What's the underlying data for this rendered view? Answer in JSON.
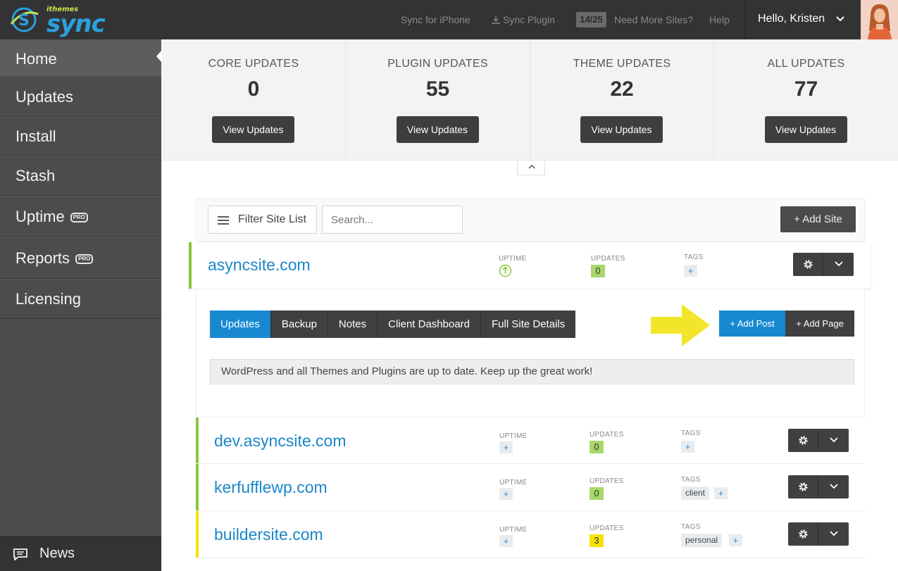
{
  "header": {
    "logo_top": "ithemes",
    "logo_main": "sync",
    "sync_iphone": "Sync for iPhone",
    "sync_plugin": "Sync Plugin",
    "quota": "14/25",
    "need_more": "Need More Sites?",
    "help": "Help",
    "greeting": "Hello, Kristen"
  },
  "sidebar": {
    "items": [
      {
        "label": "Home",
        "pro": ""
      },
      {
        "label": "Updates",
        "pro": ""
      },
      {
        "label": "Install",
        "pro": ""
      },
      {
        "label": "Stash",
        "pro": ""
      },
      {
        "label": "Uptime",
        "pro": "PRO"
      },
      {
        "label": "Reports",
        "pro": "PRO"
      },
      {
        "label": "Licensing",
        "pro": ""
      }
    ],
    "news": "News"
  },
  "stats": [
    {
      "label": "CORE UPDATES",
      "value": "0",
      "button": "View Updates"
    },
    {
      "label": "PLUGIN UPDATES",
      "value": "55",
      "button": "View Updates"
    },
    {
      "label": "THEME UPDATES",
      "value": "22",
      "button": "View Updates"
    },
    {
      "label": "ALL UPDATES",
      "value": "77",
      "button": "View Updates"
    }
  ],
  "toolbar": {
    "filter": "Filter Site List",
    "search_placeholder": "Search...",
    "add_site": "+  Add Site"
  },
  "columns": {
    "uptime": "UPTIME",
    "updates": "UPDATES",
    "tags": "TAGS"
  },
  "sites": [
    {
      "name": "asyncsite.com",
      "updates": "0",
      "tags": [],
      "bar_color": "#8cc63f"
    },
    {
      "name": "dev.asyncsite.com",
      "updates": "0",
      "tags": [],
      "bar_color": "#8cc63f"
    },
    {
      "name": "kerfufflewp.com",
      "updates": "0",
      "tags": [
        "client"
      ],
      "bar_color": "#8cc63f"
    },
    {
      "name": "buildersite.com",
      "updates": "3",
      "tags": [
        "personal"
      ],
      "bar_color": "#f5e400"
    }
  ],
  "plus": "+",
  "detail": {
    "tabs": [
      "Updates",
      "Backup",
      "Notes",
      "Client Dashboard",
      "Full Site Details"
    ],
    "add_post": "+ Add Post",
    "add_page": "+ Add Page",
    "notice": "WordPress and all Themes and Plugins are up to date. Keep up the great work!"
  },
  "colors": {
    "accent": "#1889d1",
    "ok": "#8cc63f",
    "warn": "#f5e400",
    "arrow": "#f3e62a"
  }
}
